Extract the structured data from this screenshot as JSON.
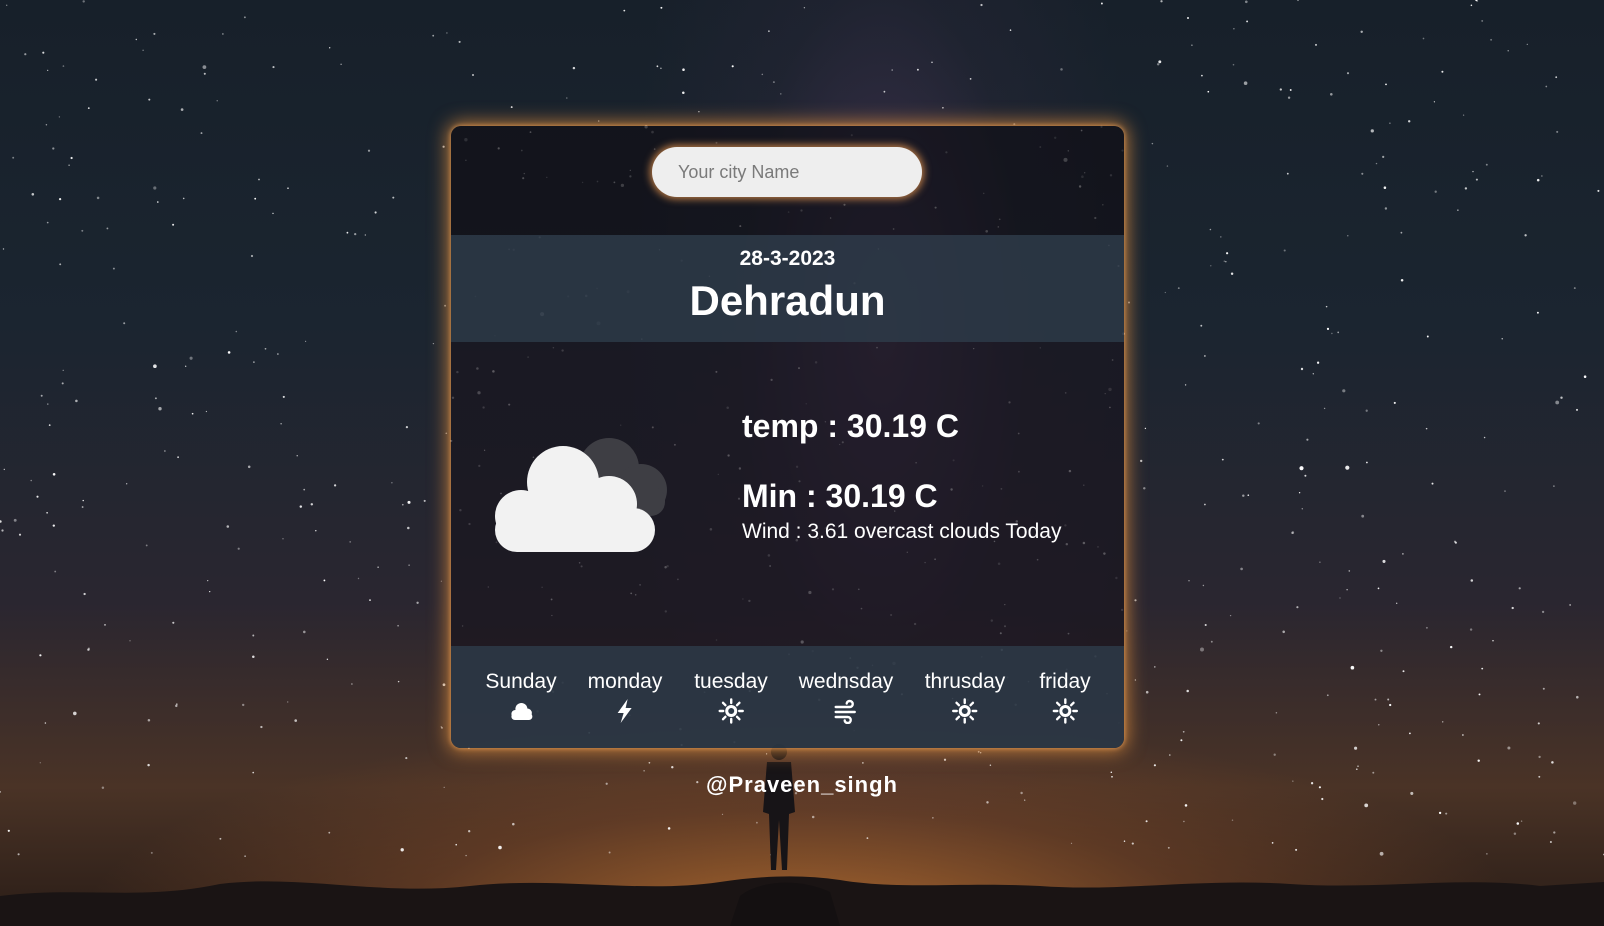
{
  "search": {
    "placeholder": "Your city Name",
    "value": ""
  },
  "header": {
    "date": "28-3-2023",
    "city": "Dehradun"
  },
  "current": {
    "icon": "overcast-clouds-icon",
    "temp_text": "temp : 30.19 C",
    "min_text": "Min : 30.19 C",
    "wind_text": "Wind : 3.61 overcast clouds Today"
  },
  "forecast": [
    {
      "day": "Sunday",
      "icon": "cloud-icon"
    },
    {
      "day": "monday",
      "icon": "lightning-icon"
    },
    {
      "day": "tuesday",
      "icon": "sun-icon"
    },
    {
      "day": "wednsday",
      "icon": "wind-icon"
    },
    {
      "day": "thrusday",
      "icon": "sun-icon"
    },
    {
      "day": "friday",
      "icon": "sun-icon"
    }
  ],
  "footer": {
    "credit": "@Praveen_singh"
  },
  "colors": {
    "card_glow": "#de8c3c",
    "band": "#2d3a48",
    "text": "#ffffff",
    "input_bg": "#eeeeee"
  }
}
